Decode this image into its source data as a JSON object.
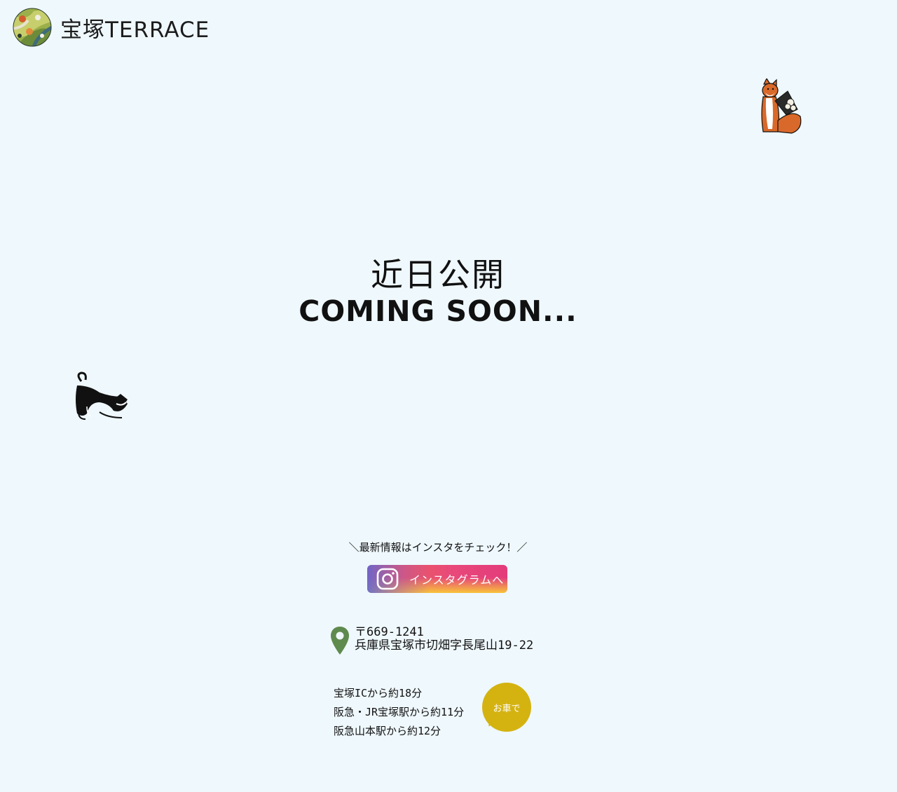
{
  "brand": {
    "logo_text": "宝塚TERRACE",
    "logo_icon": "circular-landscape-logo"
  },
  "headline": {
    "jp": "近日公開",
    "en": "COMING SOON..."
  },
  "instagram": {
    "note": "＼最新情報はインスタをチェック！／",
    "button_label": "インスタグラムへ",
    "icon": "instagram-icon"
  },
  "address": {
    "icon": "map-pin-icon",
    "postal": "〒669-1241",
    "line": "兵庫県宝塚市切畑字長尾山19-22"
  },
  "access": {
    "lines": [
      "宝塚ICから約18分",
      "阪急・JR宝塚駅から約11分",
      "阪急山本駅から約12分"
    ],
    "badge": "お車で"
  },
  "colors": {
    "background": "#eff8fd",
    "badge": "#d4b311",
    "pin": "#5f8a4e",
    "instagram_pink": "#e8497a",
    "instagram_orange": "#f9a233",
    "instagram_purple": "#5a64dc"
  }
}
